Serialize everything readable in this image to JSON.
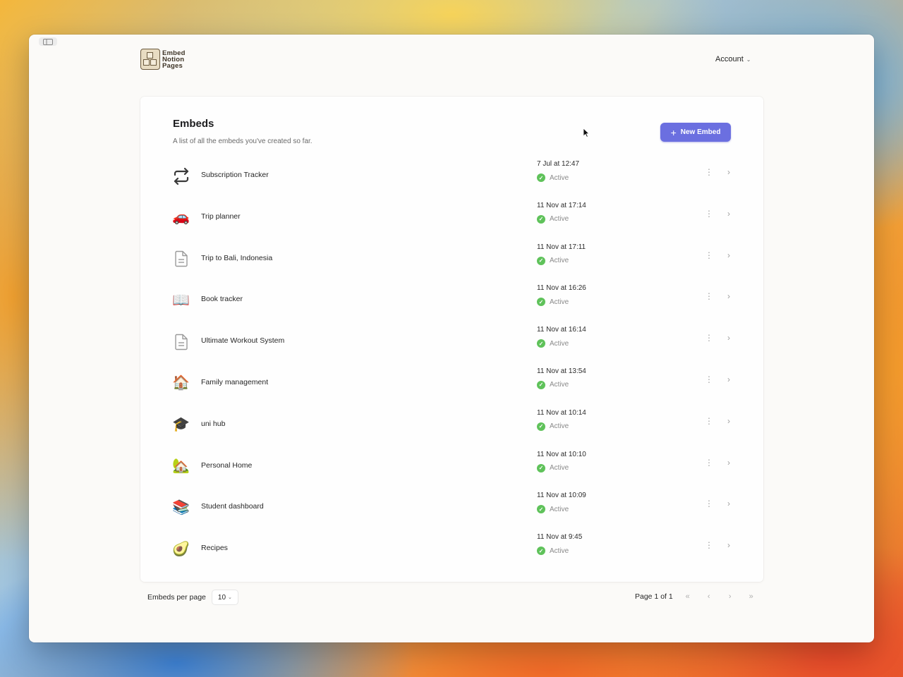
{
  "brand": {
    "logo_line1": "Embed",
    "logo_line2": "Notion",
    "logo_line3": "Pages"
  },
  "header": {
    "account_label": "Account"
  },
  "embeds": {
    "title": "Embeds",
    "subtitle": "A list of all the embeds you've created so far.",
    "new_button_label": "New Embed",
    "items": [
      {
        "icon": "repeat-arrows-icon",
        "name": "Subscription Tracker",
        "date": "7 Jul at 12:47",
        "status": "Active"
      },
      {
        "icon": "car-icon",
        "name": "Trip planner",
        "date": "11 Nov at 17:14",
        "status": "Active"
      },
      {
        "icon": "document-icon",
        "name": "Trip to Bali, Indonesia",
        "date": "11 Nov at 17:11",
        "status": "Active"
      },
      {
        "icon": "open-book-icon",
        "name": "Book tracker",
        "date": "11 Nov at 16:26",
        "status": "Active"
      },
      {
        "icon": "document-icon",
        "name": "Ultimate Workout System",
        "date": "11 Nov at 16:14",
        "status": "Active"
      },
      {
        "icon": "house-icon",
        "name": "Family management",
        "date": "11 Nov at 13:54",
        "status": "Active"
      },
      {
        "icon": "graduation-cap-icon",
        "name": "uni hub",
        "date": "11 Nov at 10:14",
        "status": "Active"
      },
      {
        "icon": "house-with-garden-icon",
        "name": "Personal Home",
        "date": "11 Nov at 10:10",
        "status": "Active"
      },
      {
        "icon": "books-icon",
        "name": "Student dashboard",
        "date": "11 Nov at 10:09",
        "status": "Active"
      },
      {
        "icon": "avocado-icon",
        "name": "Recipes",
        "date": "11 Nov at 9:45",
        "status": "Active"
      }
    ]
  },
  "pagination": {
    "per_page_label": "Embeds per page",
    "per_page_value": "10",
    "page_info": "Page 1 of 1"
  },
  "colors": {
    "accent": "#6b6fe0",
    "active_green": "#5fc25a",
    "window_bg": "#fbfaf8"
  }
}
